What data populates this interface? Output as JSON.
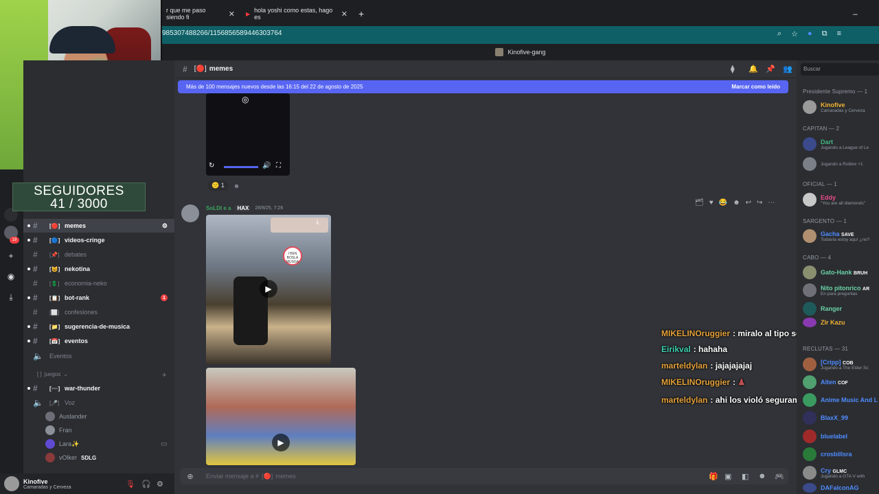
{
  "browser": {
    "tabs": [
      {
        "label": "r que me paso siendo fi",
        "close": "✕"
      },
      {
        "label": "hola yoshi como estas, hago es",
        "close": "✕"
      }
    ],
    "new_tab": "+",
    "url": "985307488266/1156856589446303764",
    "window_min": "–"
  },
  "server_title": "Kinofive-gang",
  "stream": {
    "followers_title": "SEGUIDORES",
    "followers_count": "41 / 3000"
  },
  "rail": {
    "badge1": "19",
    "badge2": "19"
  },
  "channels": [
    {
      "name": "memes",
      "emoji": "[🔴]",
      "state": "active"
    },
    {
      "name": "videos-cringe",
      "emoji": "[🔵]",
      "state": "unread"
    },
    {
      "name": "debates",
      "emoji": "[📌]",
      "state": "muted"
    },
    {
      "name": "nekotina",
      "emoji": "[😺]",
      "state": "unread"
    },
    {
      "name": "economia-neko",
      "emoji": "[💲]",
      "state": "muted"
    },
    {
      "name": "bot-rank",
      "emoji": "[📋]",
      "state": "unread",
      "badge": "1"
    },
    {
      "name": "confesiones",
      "emoji": "[⬜]",
      "state": "muted"
    },
    {
      "name": "sugerencia-de-musica",
      "emoji": "[📁]",
      "state": "unread"
    },
    {
      "name": "eventos",
      "emoji": "[📅]",
      "state": "unread"
    },
    {
      "name": "Eventos",
      "emoji": "",
      "state": "voice"
    }
  ],
  "category_juegos": "juegos",
  "voice_channels": [
    {
      "name": "war-thunder",
      "emoji": "[➖]",
      "state": "unread"
    },
    {
      "name": "Voz",
      "emoji": "[🎤]",
      "state": "voice"
    }
  ],
  "voice_users": [
    {
      "name": "Auslander"
    },
    {
      "name": "Fran"
    },
    {
      "name": "Lara✨"
    },
    {
      "name": "vOlker",
      "tag": "SDLG"
    }
  ],
  "user_panel": {
    "name": "Kinofive",
    "status": "Camaradas y Cerveza"
  },
  "chat": {
    "channel": "memes",
    "channel_emoji": "[🔴]",
    "banner_text": "Más de 100 mensajes nuevos desde las 16:15 del 22 de agosto de 2025",
    "banner_action": "Marcar como leído",
    "reaction_count": "1",
    "author": "SoLDI e a",
    "author_tag": "HAX",
    "timestamp": "28/8/25, 7:26",
    "video_sign": "I BEN BOSLA MUSGA",
    "composer_placeholder": "Enviar mensaje a #",
    "composer_channel": "memes"
  },
  "stream_chat": [
    {
      "user": "MIKELINOruggier",
      "color": "#e6a23c",
      "text": ": miralo al tipo sentado en su trono"
    },
    {
      "user": "Eirikval",
      "color": "#3ed1b0",
      "text": ": hahaha"
    },
    {
      "user": "marteldylan",
      "color": "#e6a23c",
      "text": ": jajajajajaj"
    },
    {
      "user": "MIKELINOruggier",
      "color": "#e6a23c",
      "text": ": "
    },
    {
      "user": "marteldylan",
      "color": "#e6a23c",
      "text": ": ahi los violó seguramente"
    }
  ],
  "members": {
    "search_placeholder": "Buscar",
    "roles": [
      {
        "label": "Presidente Supremo — 1"
      },
      {
        "label": "CAPITAN — 2"
      },
      {
        "label": "OFICIAL — 1"
      },
      {
        "label": "SARGENTO — 1"
      },
      {
        "label": "CABO — 4"
      },
      {
        "label": "RECLUTAS — 31"
      }
    ],
    "list": [
      {
        "name": "Kinofive",
        "activity": "Camaradas y Cerveza",
        "color": "#f0b232"
      },
      {
        "name": "Dart",
        "activity": "Jugando a League of Le",
        "color": "#43b581"
      },
      {
        "name": "",
        "activity": "Jugando a Roblox +1",
        "color": "#e03b3b"
      },
      {
        "name": "Eddy",
        "activity": "\"You are all diamonds\"",
        "color": "#e84d8a"
      },
      {
        "name": "Gacha",
        "tag": "SAVE",
        "activity": "Todavía estoy aquí ¿no?",
        "color": "#4f8cff"
      },
      {
        "name": "Gato-Hank",
        "tag": "BRUH",
        "color": "#6ad1a6"
      },
      {
        "name": "Nito pitonrico",
        "tag": "AR",
        "activity": "En para preguntas",
        "color": "#6ad1a6"
      },
      {
        "name": "Ranger",
        "color": "#6ad1a6"
      },
      {
        "name": "Zlr Kazu",
        "color": "#f0b232"
      },
      {
        "name": "[Cripp]",
        "tag": "COB",
        "activity": "Jugando a The Elder Sc",
        "color": "#4f8cff"
      },
      {
        "name": "Alten",
        "tag": "COF",
        "color": "#4f8cff"
      },
      {
        "name": "Anime Music And L",
        "color": "#4f8cff"
      },
      {
        "name": "BlaxX_99",
        "color": "#4f8cff"
      },
      {
        "name": "bluelabel",
        "color": "#4f8cff"
      },
      {
        "name": "crosbillsra",
        "color": "#4f8cff"
      },
      {
        "name": "Cry",
        "tag": "GLMC",
        "activity": "Jugando a GTA V with",
        "color": "#4f8cff"
      },
      {
        "name": "DAFalconAG",
        "color": "#4f8cff"
      }
    ]
  },
  "colors": {
    "blurple": "#5865f2",
    "alert": "#f23f42",
    "addressbar": "#0f5f66"
  }
}
